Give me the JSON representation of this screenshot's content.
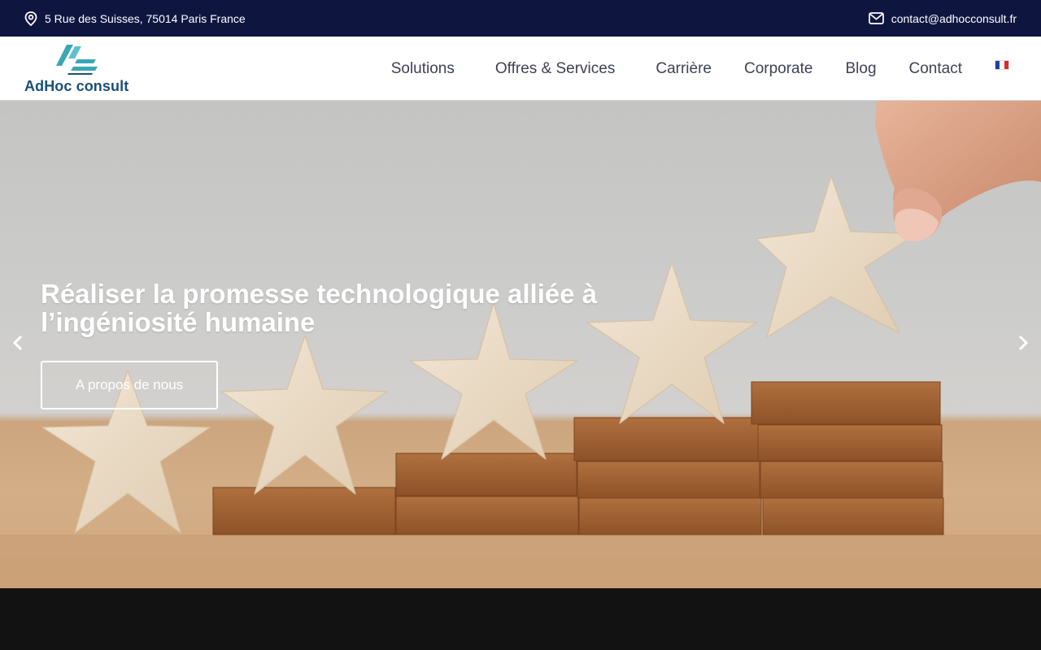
{
  "topbar": {
    "address": "5 Rue des Suisses, 75014 Paris France",
    "email": "contact@adhocconsult.fr",
    "address_icon": "map-pin-icon",
    "email_icon": "envelope-icon"
  },
  "header": {
    "logo_text": "AdHoc consult",
    "nav": [
      {
        "label": "Solutions"
      },
      {
        "label": "Offres & Services"
      },
      {
        "label": "Carrière"
      },
      {
        "label": "Corporate"
      },
      {
        "label": "Blog"
      },
      {
        "label": "Contact"
      }
    ],
    "language_icon": "french-flag-icon"
  },
  "hero": {
    "headline": "Réaliser la promesse technologique alliée à l’ingéniosité humaine",
    "cta_label": "A propos de nous",
    "prev_icon": "chevron-left-icon",
    "next_icon": "chevron-right-icon"
  },
  "colors": {
    "topbar_bg": "#0e1640",
    "logo_text": "#1a4f7a",
    "nav_text": "#3d4253",
    "logo_teal": "#3aa7b8",
    "footer_bg": "#121212"
  }
}
